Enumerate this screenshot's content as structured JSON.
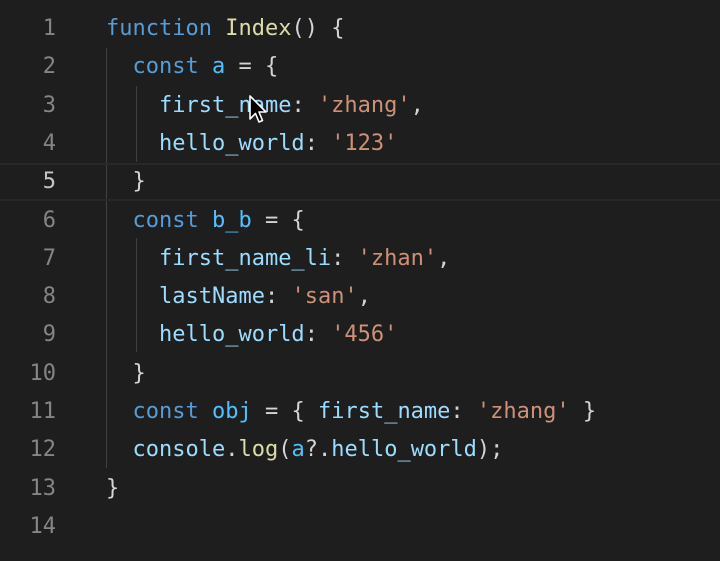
{
  "editor": {
    "lines": [
      {
        "num": "1",
        "tokens": [
          {
            "t": "function",
            "c": "kw"
          },
          {
            "t": " ",
            "c": "punc"
          },
          {
            "t": "Index",
            "c": "fn"
          },
          {
            "t": "() {",
            "c": "punc"
          }
        ]
      },
      {
        "num": "2",
        "tokens": [
          {
            "t": "  ",
            "c": "punc"
          },
          {
            "t": "const",
            "c": "kw"
          },
          {
            "t": " ",
            "c": "punc"
          },
          {
            "t": "a",
            "c": "var"
          },
          {
            "t": " = {",
            "c": "punc"
          }
        ]
      },
      {
        "num": "3",
        "tokens": [
          {
            "t": "    ",
            "c": "punc"
          },
          {
            "t": "first_name",
            "c": "prop"
          },
          {
            "t": ": ",
            "c": "punc"
          },
          {
            "t": "'zhang'",
            "c": "str"
          },
          {
            "t": ",",
            "c": "punc"
          }
        ]
      },
      {
        "num": "4",
        "tokens": [
          {
            "t": "    ",
            "c": "punc"
          },
          {
            "t": "hello_world",
            "c": "prop"
          },
          {
            "t": ": ",
            "c": "punc"
          },
          {
            "t": "'123'",
            "c": "str"
          }
        ]
      },
      {
        "num": "5",
        "tokens": [
          {
            "t": "  }",
            "c": "punc"
          }
        ]
      },
      {
        "num": "6",
        "tokens": [
          {
            "t": "  ",
            "c": "punc"
          },
          {
            "t": "const",
            "c": "kw"
          },
          {
            "t": " ",
            "c": "punc"
          },
          {
            "t": "b_b",
            "c": "var"
          },
          {
            "t": " = {",
            "c": "punc"
          }
        ]
      },
      {
        "num": "7",
        "tokens": [
          {
            "t": "    ",
            "c": "punc"
          },
          {
            "t": "first_name_li",
            "c": "prop"
          },
          {
            "t": ": ",
            "c": "punc"
          },
          {
            "t": "'zhan'",
            "c": "str"
          },
          {
            "t": ",",
            "c": "punc"
          }
        ]
      },
      {
        "num": "8",
        "tokens": [
          {
            "t": "    ",
            "c": "punc"
          },
          {
            "t": "lastName",
            "c": "prop"
          },
          {
            "t": ": ",
            "c": "punc"
          },
          {
            "t": "'san'",
            "c": "str"
          },
          {
            "t": ",",
            "c": "punc"
          }
        ]
      },
      {
        "num": "9",
        "tokens": [
          {
            "t": "    ",
            "c": "punc"
          },
          {
            "t": "hello_world",
            "c": "prop"
          },
          {
            "t": ": ",
            "c": "punc"
          },
          {
            "t": "'456'",
            "c": "str"
          }
        ]
      },
      {
        "num": "10",
        "tokens": [
          {
            "t": "  }",
            "c": "punc"
          }
        ]
      },
      {
        "num": "11",
        "tokens": [
          {
            "t": "  ",
            "c": "punc"
          },
          {
            "t": "const",
            "c": "kw"
          },
          {
            "t": " ",
            "c": "punc"
          },
          {
            "t": "obj",
            "c": "var"
          },
          {
            "t": " = { ",
            "c": "punc"
          },
          {
            "t": "first_name",
            "c": "prop"
          },
          {
            "t": ": ",
            "c": "punc"
          },
          {
            "t": "'zhang'",
            "c": "str"
          },
          {
            "t": " }",
            "c": "punc"
          }
        ]
      },
      {
        "num": "12",
        "tokens": [
          {
            "t": "  ",
            "c": "punc"
          },
          {
            "t": "console",
            "c": "prop"
          },
          {
            "t": ".",
            "c": "punc"
          },
          {
            "t": "log",
            "c": "fn"
          },
          {
            "t": "(",
            "c": "punc"
          },
          {
            "t": "a",
            "c": "var"
          },
          {
            "t": "?.",
            "c": "punc"
          },
          {
            "t": "hello_world",
            "c": "prop"
          },
          {
            "t": ");",
            "c": "punc"
          }
        ]
      },
      {
        "num": "13",
        "tokens": [
          {
            "t": "}",
            "c": "punc"
          }
        ]
      },
      {
        "num": "14",
        "tokens": []
      }
    ],
    "current_line": "5",
    "colors": {
      "background": "#1e1e1e",
      "keyword": "#569cd6",
      "function": "#dcdcaa",
      "property": "#9cdcfe",
      "variable": "#4fc1ff",
      "string": "#ce9178",
      "line_number": "#858585"
    },
    "icons": {
      "cursor": "mouse-pointer-icon"
    }
  }
}
